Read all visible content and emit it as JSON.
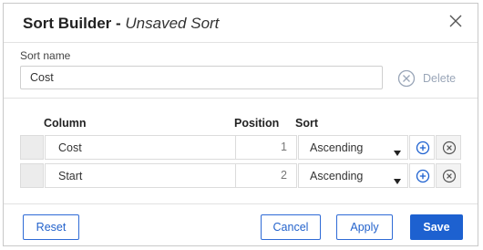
{
  "dialog": {
    "title": "Sort Builder -",
    "subtitle": "Unsaved Sort",
    "close_icon": "close-icon"
  },
  "sort_name": {
    "label": "Sort name",
    "value": "Cost",
    "delete_label": "Delete"
  },
  "columns": {
    "column": "Column",
    "position": "Position",
    "sort": "Sort"
  },
  "rows": [
    {
      "column": "Cost",
      "position": "1",
      "sort": "Ascending"
    },
    {
      "column": "Start",
      "position": "2",
      "sort": "Ascending"
    }
  ],
  "footer": {
    "reset": "Reset",
    "cancel": "Cancel",
    "apply": "Apply",
    "save": "Save"
  },
  "colors": {
    "accent": "#1d61d0",
    "muted": "#9aa6b8"
  }
}
